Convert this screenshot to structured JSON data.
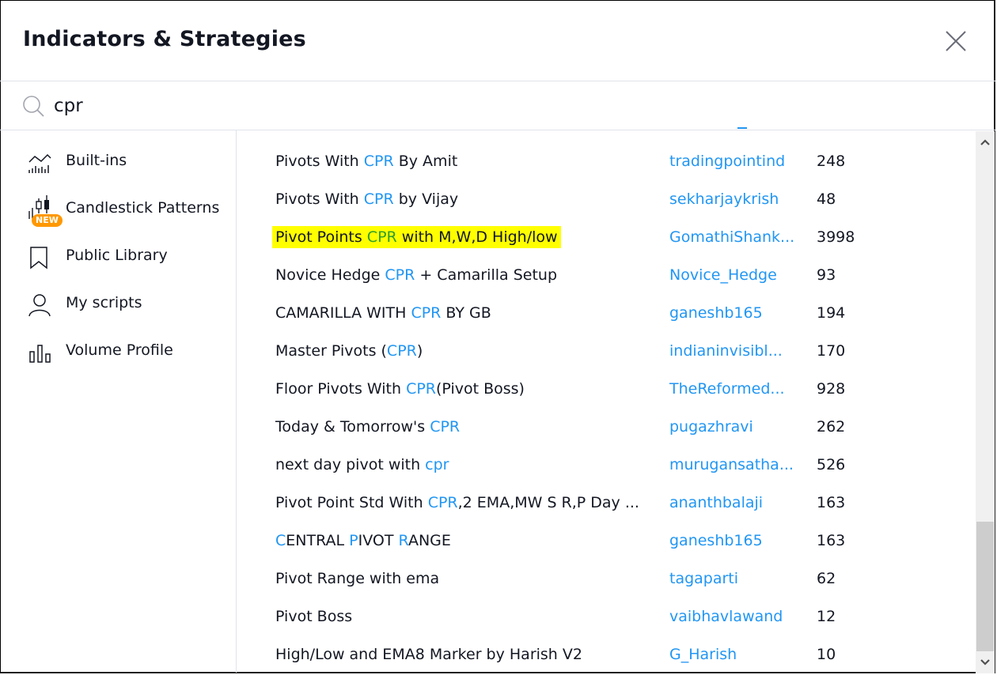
{
  "dialog": {
    "title": "Indicators & Strategies",
    "close_icon": "close-icon"
  },
  "search": {
    "icon": "search-icon",
    "value": "cpr",
    "placeholder": "Search"
  },
  "sidebar": {
    "items": [
      {
        "label": "Built-ins",
        "icon": "chart-line-bars-icon"
      },
      {
        "label": "Candlestick Patterns",
        "icon": "candlestick-icon",
        "badge": "NEW"
      },
      {
        "label": "Public Library",
        "icon": "bookmark-icon"
      },
      {
        "label": "My scripts",
        "icon": "user-icon"
      },
      {
        "label": "Volume Profile",
        "icon": "volume-bars-icon"
      }
    ]
  },
  "results": {
    "highlight_color": "#2196f3",
    "rows": [
      {
        "name_parts": [
          [
            "Pivots With ",
            false
          ],
          [
            "CPR",
            true
          ],
          [
            " By Amit",
            false
          ]
        ],
        "author": "tradingpointind",
        "likes": "248"
      },
      {
        "name_parts": [
          [
            "Pivots With ",
            false
          ],
          [
            "CPR",
            true
          ],
          [
            " by Vijay",
            false
          ]
        ],
        "author": "sekharjaykrish",
        "likes": "48"
      },
      {
        "name_parts": [
          [
            "Pivot Points ",
            false
          ],
          [
            "CPR",
            true
          ],
          [
            " with M,W,D High/low",
            false
          ]
        ],
        "author": "GomathiShank...",
        "likes": "3998",
        "marked": true
      },
      {
        "name_parts": [
          [
            "Novice Hedge ",
            false
          ],
          [
            "CPR",
            true
          ],
          [
            " + Camarilla Setup",
            false
          ]
        ],
        "author": "Novice_Hedge",
        "likes": "93"
      },
      {
        "name_parts": [
          [
            "CAMARILLA WITH ",
            false
          ],
          [
            "CPR",
            true
          ],
          [
            " BY GB",
            false
          ]
        ],
        "author": "ganeshb165",
        "likes": "194"
      },
      {
        "name_parts": [
          [
            "Master Pivots (",
            false
          ],
          [
            "CPR",
            true
          ],
          [
            ")",
            false
          ]
        ],
        "author": "indianinvisibl...",
        "likes": "170"
      },
      {
        "name_parts": [
          [
            "Floor Pivots With ",
            false
          ],
          [
            "CPR",
            true
          ],
          [
            "(Pivot Boss)",
            false
          ]
        ],
        "author": "TheReformed...",
        "likes": "928"
      },
      {
        "name_parts": [
          [
            "Today & Tomorrow's ",
            false
          ],
          [
            "CPR",
            true
          ]
        ],
        "author": "pugazhravi",
        "likes": "262"
      },
      {
        "name_parts": [
          [
            "next day pivot with ",
            false
          ],
          [
            "cpr",
            true
          ]
        ],
        "author": "murugansatha...",
        "likes": "526"
      },
      {
        "name_parts": [
          [
            "Pivot Point Std With ",
            false
          ],
          [
            "CPR",
            true
          ],
          [
            ",2 EMA,MW S R,P Day ...",
            false
          ]
        ],
        "author": "ananthbalaji",
        "likes": "163"
      },
      {
        "name_parts": [
          [
            "C",
            true
          ],
          [
            "ENTRAL ",
            false
          ],
          [
            "P",
            true
          ],
          [
            "IVOT ",
            false
          ],
          [
            "R",
            true
          ],
          [
            "ANGE",
            false
          ]
        ],
        "author": "ganeshb165",
        "likes": "163"
      },
      {
        "name_parts": [
          [
            "Pivot Range with ema",
            false
          ]
        ],
        "author": "tagaparti",
        "likes": "62"
      },
      {
        "name_parts": [
          [
            "Pivot Boss",
            false
          ]
        ],
        "author": "vaibhavlawand",
        "likes": "12"
      },
      {
        "name_parts": [
          [
            "High/Low and EMA8 Marker by Harish V2",
            false
          ]
        ],
        "author": "G_Harish",
        "likes": "10"
      }
    ]
  },
  "scrollbar": {
    "up_icon": "chevron-up-icon",
    "down_icon": "chevron-down-icon",
    "position_fraction": 0.85
  }
}
